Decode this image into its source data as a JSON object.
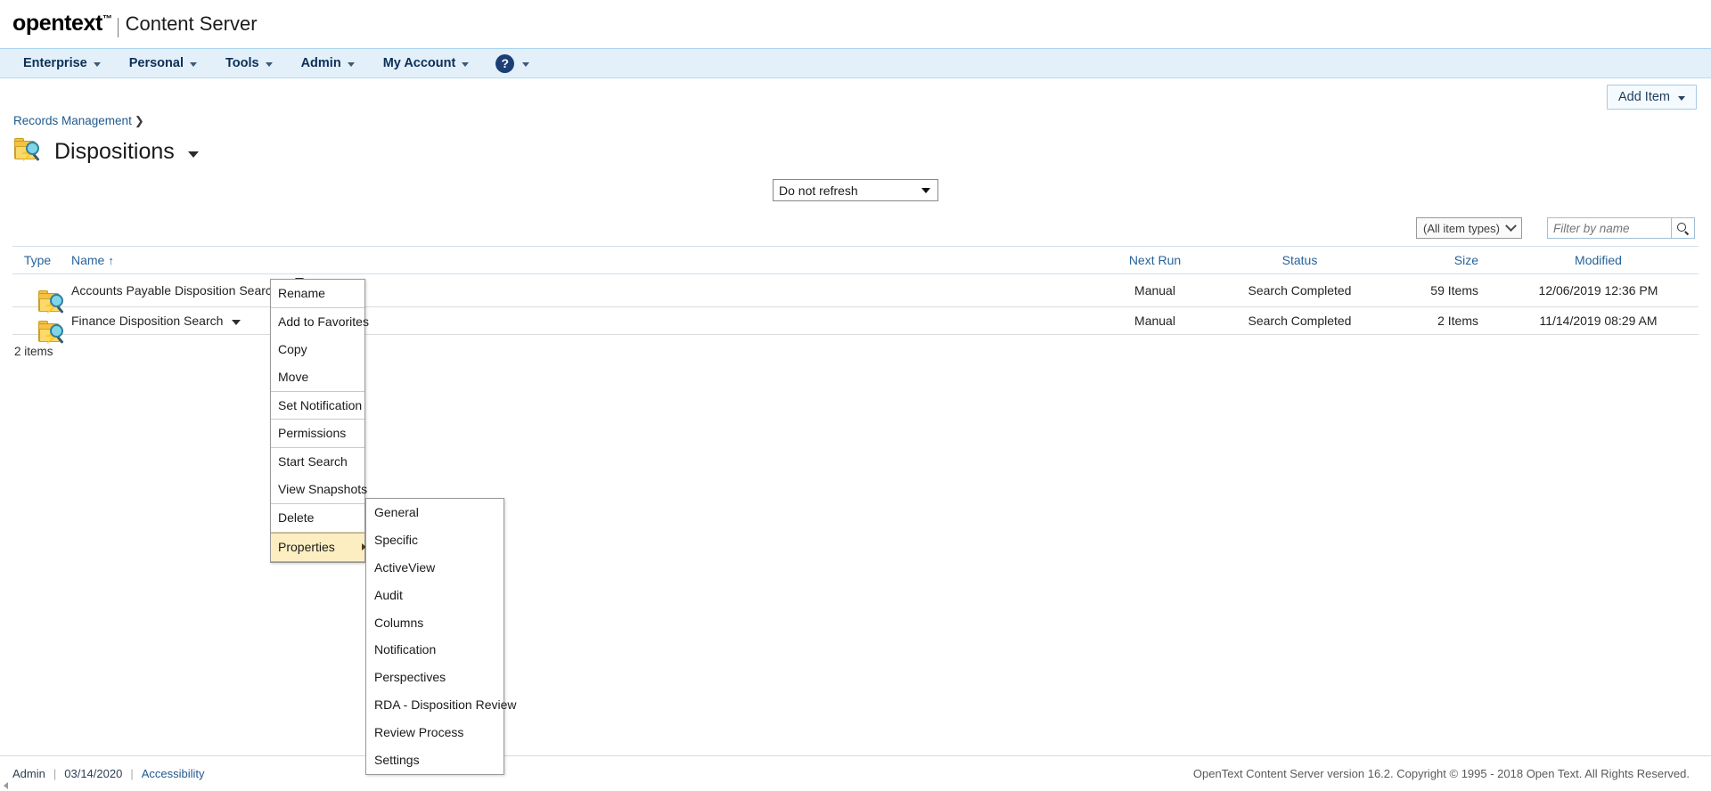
{
  "brand": {
    "logo": "opentext",
    "tm": "™",
    "app_name": "Content Server"
  },
  "menubar": {
    "items": [
      {
        "label": "Enterprise",
        "icon": "chevron-down-icon"
      },
      {
        "label": "Personal",
        "icon": "chevron-down-icon"
      },
      {
        "label": "Tools",
        "icon": "chevron-down-icon"
      },
      {
        "label": "Admin",
        "icon": "chevron-down-icon"
      },
      {
        "label": "My Account",
        "icon": "chevron-down-icon"
      }
    ],
    "help": {
      "glyph": "?",
      "icon": "help-icon"
    }
  },
  "toolbar": {
    "add_item_label": "Add Item",
    "add_item_icon": "chevron-down-icon"
  },
  "breadcrumb": {
    "items": [
      {
        "label": "Records Management"
      }
    ],
    "separator": "❯"
  },
  "page_title": {
    "text": "Dispositions",
    "icon": "disposition-search-folder-icon",
    "menu_icon": "chevron-down-icon"
  },
  "refresh": {
    "selected": "Do not refresh",
    "options": [
      "Do not refresh"
    ],
    "icon": "chevron-down-icon"
  },
  "filters": {
    "type_filter_value": "(All item types)",
    "type_filter_icon": "chevron-down-icon",
    "name_filter_placeholder": "Filter by name",
    "name_filter_value": "",
    "search_icon": "search-icon"
  },
  "table": {
    "columns": [
      {
        "key": "type",
        "label": "Type"
      },
      {
        "key": "name",
        "label": "Name",
        "sorted": true,
        "sort_icon": "↑"
      },
      {
        "key": "next_run",
        "label": "Next Run"
      },
      {
        "key": "status",
        "label": "Status"
      },
      {
        "key": "size",
        "label": "Size"
      },
      {
        "key": "modified",
        "label": "Modified"
      }
    ],
    "rows": [
      {
        "icon": "disposition-search-folder-icon",
        "name": "Accounts Payable Disposition Search",
        "next_run": "Manual",
        "status": "Search Completed",
        "size": "59 Items",
        "modified": "12/06/2019 12:36 PM"
      },
      {
        "icon": "disposition-search-folder-icon",
        "name": "Finance Disposition Search",
        "next_run": "Manual",
        "status": "Search Completed",
        "size": "2 Items",
        "modified": "11/14/2019 08:29 AM"
      }
    ],
    "items_count": "2 items"
  },
  "context_menu": {
    "items": [
      {
        "label": "Rename",
        "group_end": true
      },
      {
        "label": "Add to Favorites"
      },
      {
        "label": "Copy"
      },
      {
        "label": "Move",
        "group_end": true
      },
      {
        "label": "Set Notification",
        "group_end": true
      },
      {
        "label": "Permissions",
        "group_end": true
      },
      {
        "label": "Start Search"
      },
      {
        "label": "View Snapshots",
        "group_end": true
      },
      {
        "label": "Delete",
        "group_end": true
      },
      {
        "label": "Properties",
        "selected": true,
        "has_submenu": true
      }
    ]
  },
  "properties_submenu": {
    "items": [
      {
        "label": "General"
      },
      {
        "label": "Specific"
      },
      {
        "label": "ActiveView"
      },
      {
        "label": "Audit"
      },
      {
        "label": "Columns"
      },
      {
        "label": "Notification"
      },
      {
        "label": "Perspectives"
      },
      {
        "label": "RDA - Disposition Review"
      },
      {
        "label": "Review Process"
      },
      {
        "label": "Settings"
      }
    ]
  },
  "footer": {
    "user": "Admin",
    "date": "03/14/2020",
    "accessibility": "Accessibility",
    "separator": "|",
    "copyright": "OpenText Content Server version 16.2. Copyright © 1995 - 2018 Open Text. All Rights Reserved."
  },
  "colors": {
    "menubar_bg": "#e3f0f9",
    "link": "#215a8f",
    "header_text": "#27639b",
    "selected_menu": "#fdeec2",
    "selected_menu_border": "#e0a830"
  }
}
